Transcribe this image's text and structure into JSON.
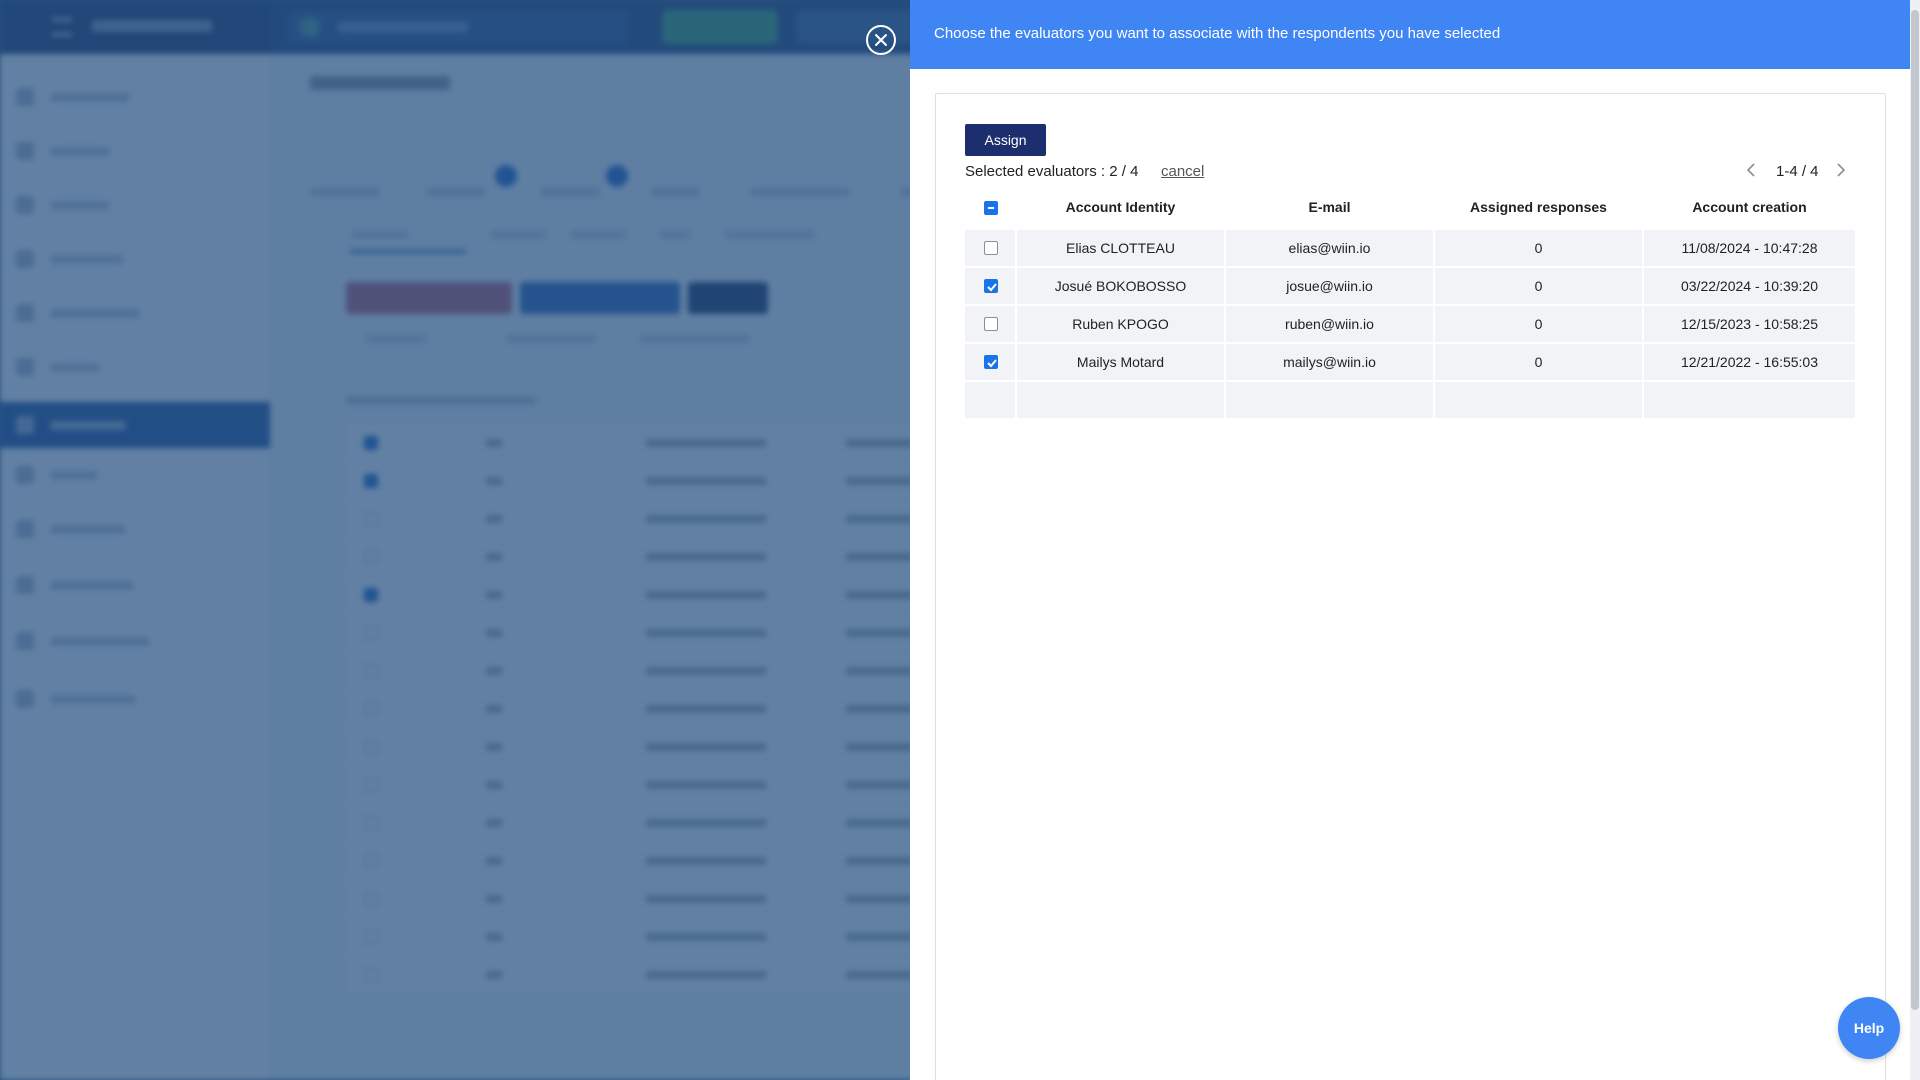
{
  "drawer": {
    "title": "Choose the evaluators you want to associate with the respondents you have selected",
    "assign_label": "Assign",
    "selected_label": "Selected evaluators : 2 / 4",
    "cancel_label": "cancel",
    "pager_text": "1-4 / 4"
  },
  "table": {
    "headers": [
      "Account Identity",
      "E-mail",
      "Assigned responses",
      "Account creation"
    ],
    "rows": [
      {
        "name": "Elias CLOTTEAU",
        "email": "elias@wiin.io",
        "assigned": "0",
        "created": "11/08/2024 - 10:47:28",
        "checked": false
      },
      {
        "name": "Josué BOKOBOSSO",
        "email": "josue@wiin.io",
        "assigned": "0",
        "created": "03/22/2024 - 10:39:20",
        "checked": true
      },
      {
        "name": "Ruben KPOGO",
        "email": "ruben@wiin.io",
        "assigned": "0",
        "created": "12/15/2023 - 10:58:25",
        "checked": false
      },
      {
        "name": "Mailys Motard",
        "email": "mailys@wiin.io",
        "assigned": "0",
        "created": "12/21/2022 - 16:55:03",
        "checked": true
      }
    ]
  },
  "help_label": "Help",
  "icons": {
    "close": "close-circle-icon",
    "prev": "chevron-left-icon",
    "next": "chevron-right-icon"
  },
  "colors": {
    "header_bg": "#3f85f4",
    "assign_bg": "#1c2e6e",
    "checkbox_on": "#1a73e8"
  }
}
